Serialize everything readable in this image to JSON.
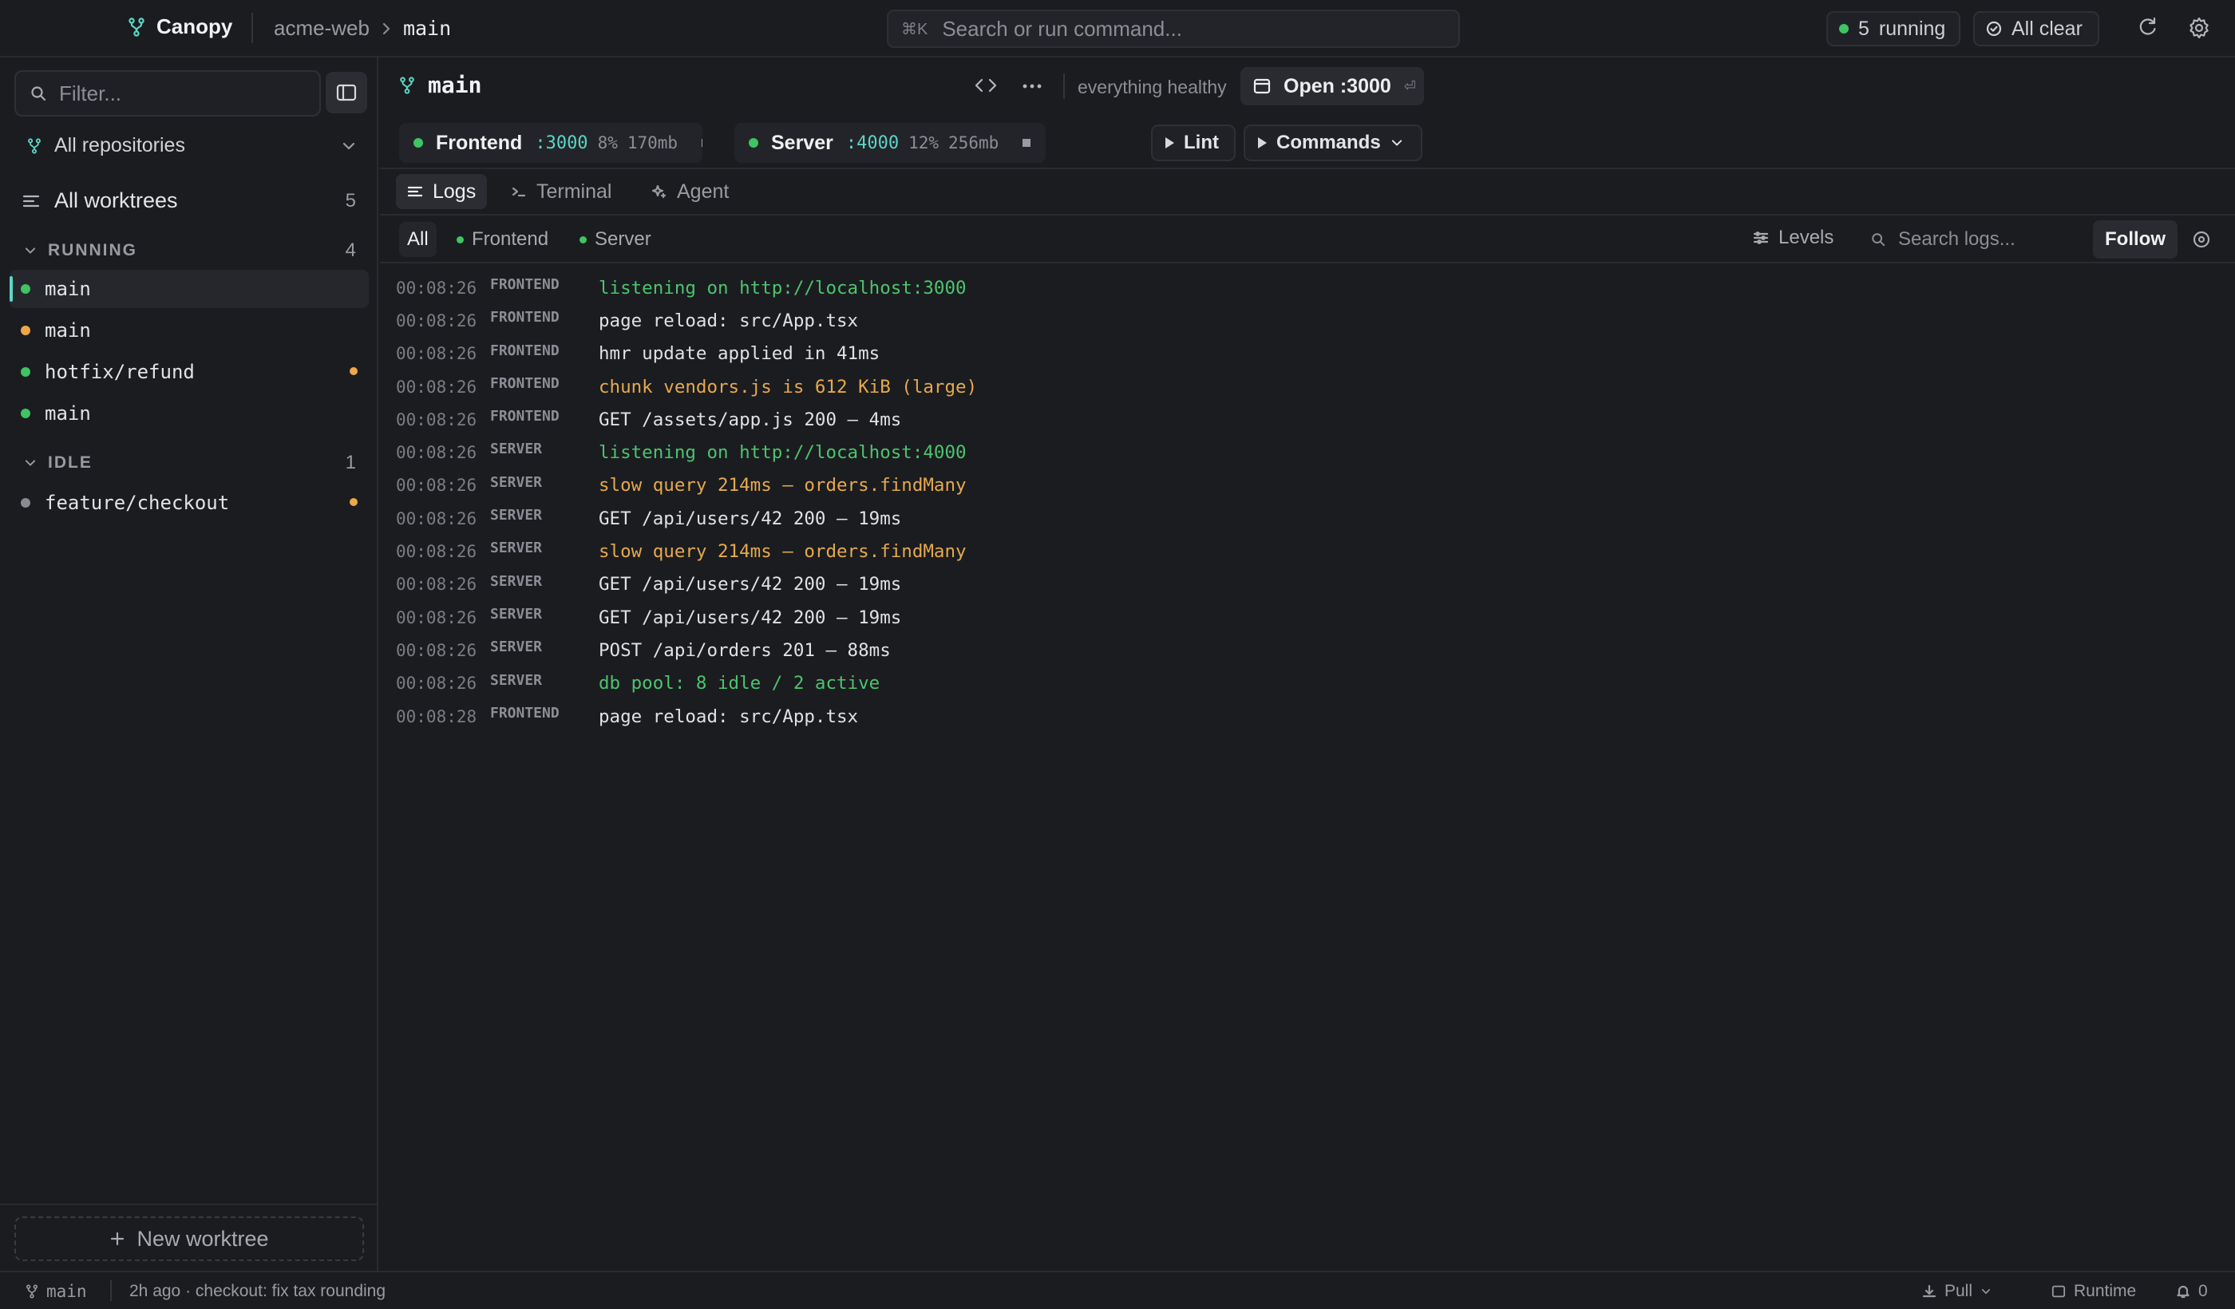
{
  "topbar": {
    "brand": "Canopy",
    "repo": "acme-web",
    "branch": "main",
    "command_shortcut": "⌘K",
    "command_placeholder": "Search or run command...",
    "running_count": "5",
    "running_label": "running",
    "clear_label": "All clear"
  },
  "sidebar": {
    "filter_placeholder": "Filter...",
    "repo_select": "All repositories",
    "all_worktrees": {
      "label": "All worktrees",
      "count": "5"
    },
    "groups": [
      {
        "title": "RUNNING",
        "count": "4",
        "items": [
          {
            "label": "main",
            "status": "green",
            "active": true,
            "flag": false
          },
          {
            "label": "main",
            "status": "amber",
            "active": false,
            "flag": false
          },
          {
            "label": "hotfix/refund",
            "status": "green",
            "active": false,
            "flag": true
          },
          {
            "label": "main",
            "status": "green",
            "active": false,
            "flag": false
          }
        ]
      },
      {
        "title": "IDLE",
        "count": "1",
        "items": [
          {
            "label": "feature/checkout",
            "status": "grey",
            "active": false,
            "flag": true
          }
        ]
      }
    ],
    "new_worktree": "New worktree"
  },
  "main": {
    "title": "main",
    "health": "everything healthy",
    "open_button": "Open :3000",
    "open_shortcut": "⏎",
    "processes": [
      {
        "name": "Frontend",
        "port": ":3000",
        "cpu": "8%",
        "mem": "170mb"
      },
      {
        "name": "Server",
        "port": ":4000",
        "cpu": "12%",
        "mem": "256mb"
      }
    ],
    "lint_button": "Lint",
    "commands_button": "Commands",
    "tabs": [
      "Logs",
      "Terminal",
      "Agent"
    ],
    "filters": [
      "All",
      "Frontend",
      "Server"
    ],
    "levels_label": "Levels",
    "search_logs_placeholder": "Search logs...",
    "follow_label": "Follow",
    "logs": [
      {
        "ts": "00:08:26",
        "src": "FRONTEND",
        "msg": "listening on http://localhost:3000",
        "level": "ok"
      },
      {
        "ts": "00:08:26",
        "src": "FRONTEND",
        "msg": "page reload: src/App.tsx",
        "level": "info"
      },
      {
        "ts": "00:08:26",
        "src": "FRONTEND",
        "msg": "hmr update applied in 41ms",
        "level": "info"
      },
      {
        "ts": "00:08:26",
        "src": "FRONTEND",
        "msg": "chunk vendors.js is 612 KiB (large)",
        "level": "warn"
      },
      {
        "ts": "00:08:26",
        "src": "FRONTEND",
        "msg": "GET /assets/app.js 200 — 4ms",
        "level": "info"
      },
      {
        "ts": "00:08:26",
        "src": "SERVER",
        "msg": "listening on http://localhost:4000",
        "level": "ok"
      },
      {
        "ts": "00:08:26",
        "src": "SERVER",
        "msg": "slow query 214ms — orders.findMany",
        "level": "warn"
      },
      {
        "ts": "00:08:26",
        "src": "SERVER",
        "msg": "GET /api/users/42 200 — 19ms",
        "level": "info"
      },
      {
        "ts": "00:08:26",
        "src": "SERVER",
        "msg": "slow query 214ms — orders.findMany",
        "level": "warn"
      },
      {
        "ts": "00:08:26",
        "src": "SERVER",
        "msg": "GET /api/users/42 200 — 19ms",
        "level": "info"
      },
      {
        "ts": "00:08:26",
        "src": "SERVER",
        "msg": "GET /api/users/42 200 — 19ms",
        "level": "info"
      },
      {
        "ts": "00:08:26",
        "src": "SERVER",
        "msg": "POST /api/orders 201 — 88ms",
        "level": "info"
      },
      {
        "ts": "00:08:26",
        "src": "SERVER",
        "msg": "db pool: 8 idle / 2 active",
        "level": "ok"
      },
      {
        "ts": "00:08:28",
        "src": "FRONTEND",
        "msg": "page reload: src/App.tsx",
        "level": "info"
      }
    ]
  },
  "statusbar": {
    "branch": "main",
    "last_commit": "2h ago · checkout: fix tax rounding",
    "pull": "Pull",
    "runtime": "Runtime",
    "notifications": "0"
  },
  "colors": {
    "accent": "#5bd6c7",
    "ok": "#3fc463",
    "warn": "#eda84a",
    "idle": "#8a8b92",
    "background": "#1b1c20"
  }
}
